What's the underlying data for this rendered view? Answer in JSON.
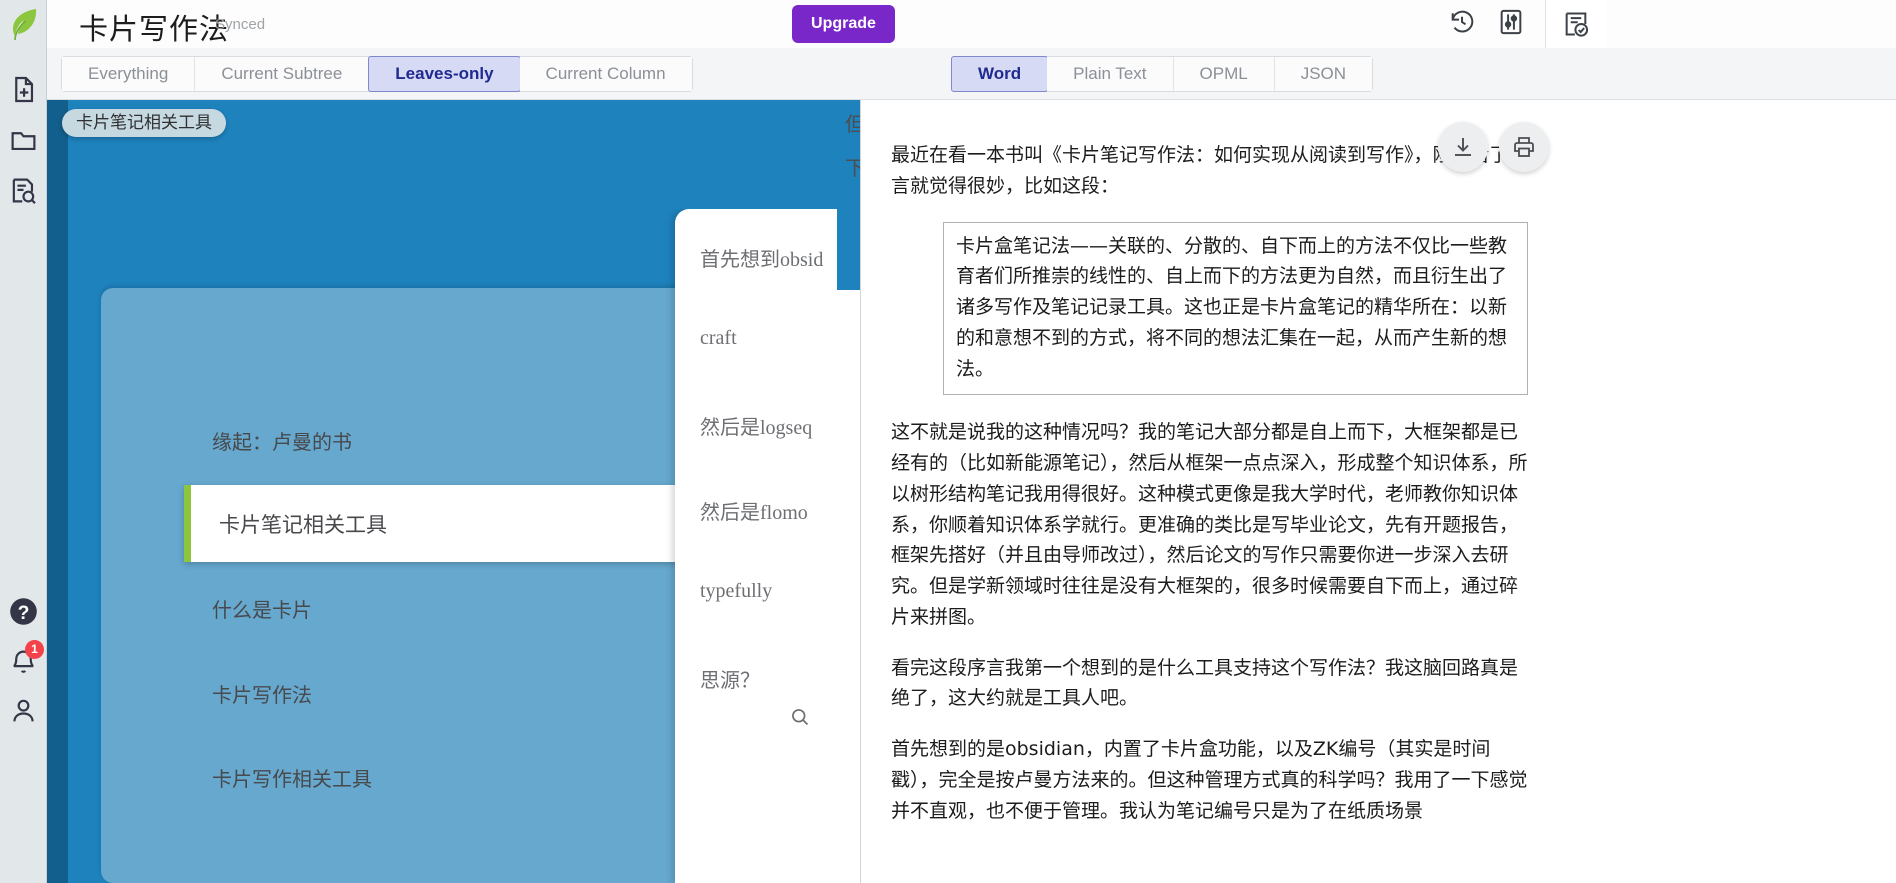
{
  "app": {
    "logo_icon": "leaf-logo-icon"
  },
  "header": {
    "title": "卡片写作法",
    "sync_status": "Synced",
    "upgrade_label": "Upgrade",
    "icons": {
      "history": "history-icon",
      "sliders": "sliders-icon",
      "outline": "outline-check-icon"
    }
  },
  "rail": {
    "new_document": "new-document-icon",
    "folder": "folder-icon",
    "document_search": "document-search-icon",
    "help": "help-icon",
    "notifications": "bell-icon",
    "notification_count": "1",
    "account": "user-icon"
  },
  "tabs": {
    "scope": [
      {
        "label": "Everything",
        "active": false
      },
      {
        "label": "Current Subtree",
        "active": false
      },
      {
        "label": "Leaves-only",
        "active": true
      },
      {
        "label": "Current Column",
        "active": false
      }
    ],
    "format": [
      {
        "label": "Word",
        "active": true
      },
      {
        "label": "Plain Text",
        "active": false
      },
      {
        "label": "OPML",
        "active": false
      },
      {
        "label": "JSON",
        "active": false
      }
    ]
  },
  "treemap": {
    "tooltip": "卡片笔记相关工具",
    "selected_label": "卡片笔记相关工具",
    "leaves": {
      "origin": "缘起：卢曼的书",
      "what_is_card": "什么是卡片",
      "card_method": "卡片写作法",
      "card_related_tools": "卡片写作相关工具"
    },
    "column2": {
      "obsidian": "首先想到obsid",
      "craft": "craft",
      "logseq": "然后是logseq",
      "flomo": "然后是flomo",
      "typefully": "typefully",
      "siyuan": "思源？",
      "search_icon": "search-icon"
    },
    "overlap_lines": [
      "但是学新领域时",
      "下而上，通过碎"
    ],
    "colors": {
      "root": "#1e82bd",
      "edge": "#125e8c",
      "level2": "#66a8ce",
      "selected_accent": "#8cc63e",
      "tooltip_bg": "#c7d9e0"
    }
  },
  "document": {
    "actions": {
      "download": "download-icon",
      "print": "print-icon"
    },
    "paragraphs": [
      "最近在看一本书叫《卡片笔记写作法：如何实现从阅读到写作》，刚刚看了序言就觉得很妙，比如这段："
    ],
    "quote": "卡片盒笔记法——关联的、分散的、自下而上的方法不仅比一些教育者们所推崇的线性的、自上而下的方法更为自然，而且衍生出了诸多写作及笔记记录工具。这也正是卡片盒笔记的精华所在：以新的和意想不到的方式，将不同的想法汇集在一起，从而产生新的想法。",
    "paragraphs_after": [
      "这不就是说我的这种情况吗？我的笔记大部分都是自上而下，大框架都是已经有的（比如新能源笔记），然后从框架一点点深入，形成整个知识体系，所以树形结构笔记我用得很好。这种模式更像是我大学时代，老师教你知识体系，你顺着知识体系学就行。更准确的类比是写毕业论文，先有开题报告，框架先搭好（并且由导师改过），然后论文的写作只需要你进一步深入去研究。但是学新领域时往往是没有大框架的，很多时候需要自下而上，通过碎片来拼图。",
      "看完这段序言我第一个想到的是什么工具支持这个写作法？我这脑回路真是绝了，这大约就是工具人吧。",
      "首先想到的是obsidian，内置了卡片盒功能，以及ZK编号（其实是时间戳），完全是按卢曼方法来的。但这种管理方式真的科学吗？我用了一下感觉并不直观，也不便于管理。我认为笔记编号只是为了在纸质场景"
    ]
  }
}
